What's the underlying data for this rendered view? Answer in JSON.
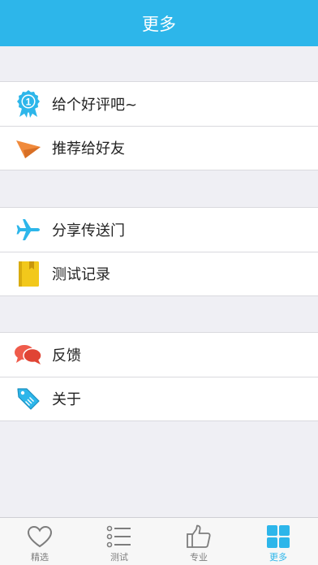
{
  "header": {
    "title": "更多"
  },
  "groups": [
    {
      "items": [
        {
          "label": "给个好评吧~",
          "icon": "award-ribbon-icon"
        },
        {
          "label": "推荐给好友",
          "icon": "paper-plane-icon"
        }
      ]
    },
    {
      "items": [
        {
          "label": "分享传送门",
          "icon": "airplane-icon"
        },
        {
          "label": "测试记录",
          "icon": "notebook-icon"
        }
      ]
    },
    {
      "items": [
        {
          "label": "反馈",
          "icon": "chat-bubbles-icon"
        },
        {
          "label": "关于",
          "icon": "tag-icon"
        }
      ]
    }
  ],
  "badge_number": "1",
  "tabbar": {
    "active": "更多",
    "tabs": [
      {
        "label": "精选",
        "icon": "heart-icon"
      },
      {
        "label": "测试",
        "icon": "list-icon"
      },
      {
        "label": "专业",
        "icon": "thumbs-up-icon"
      },
      {
        "label": "更多",
        "icon": "grid-icon"
      }
    ]
  },
  "colors": {
    "accent": "#2db6ea",
    "plane": "#f08a3c",
    "notebook": "#f2c81b",
    "chat": "#ef5b4b",
    "inactive": "#7d7d7d"
  }
}
